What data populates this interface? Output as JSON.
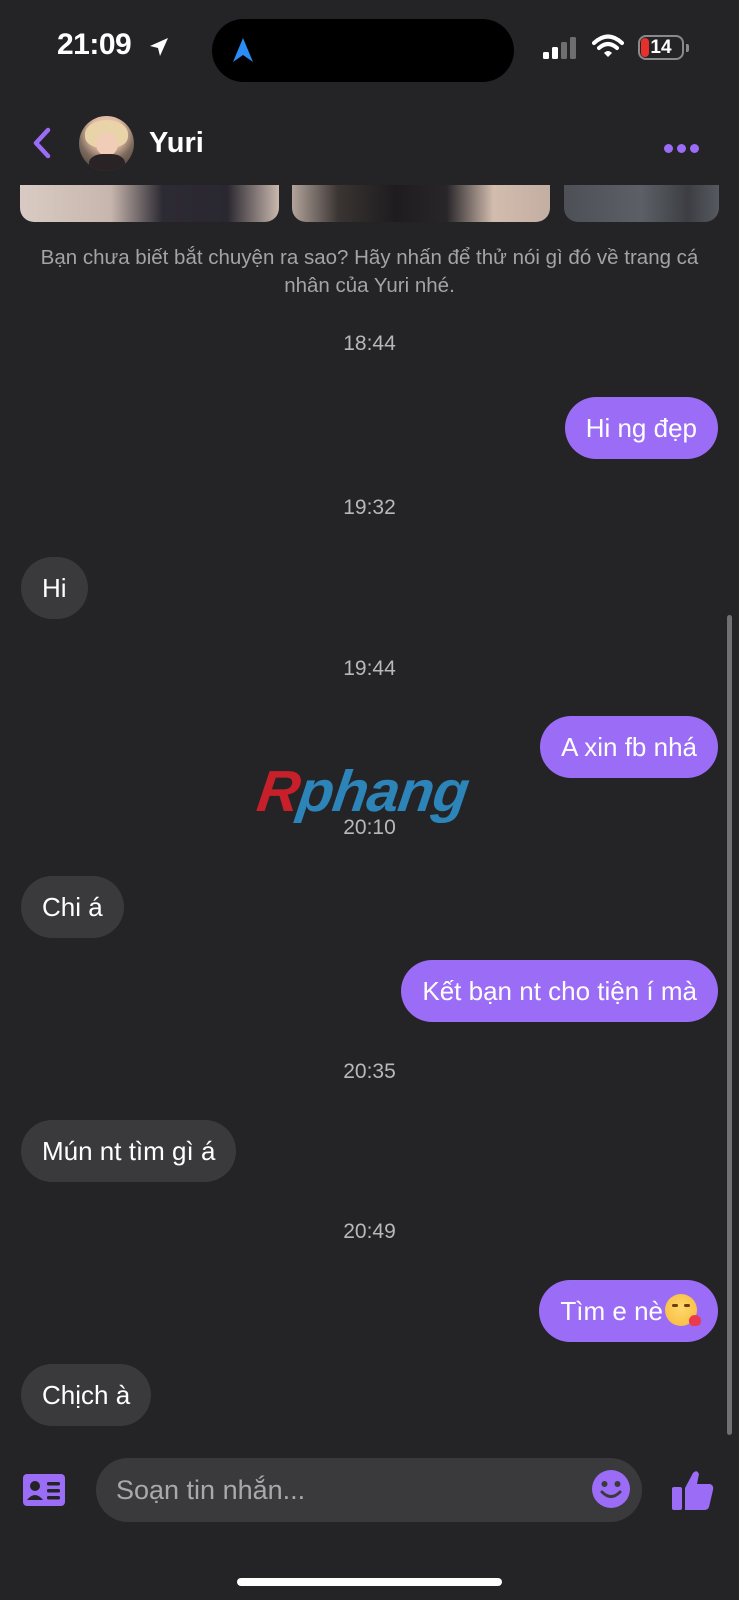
{
  "status_bar": {
    "time": "21:09",
    "battery": "14",
    "icons": [
      "location-arrow-icon",
      "navigation-icon",
      "signal-icon",
      "wifi-icon",
      "battery-icon"
    ]
  },
  "header": {
    "contact_name": "Yuri",
    "icons": [
      "back-chevron-icon",
      "avatar",
      "more-dots-icon"
    ],
    "accent_color": "#9b6cf6"
  },
  "intro": {
    "text": "Bạn chưa biết bắt chuyện ra sao? Hãy nhấn để thử nói gì đó về trang cá nhân của Yuri nhé."
  },
  "messages": [
    {
      "type": "timestamp",
      "text": "18:44"
    },
    {
      "type": "outgoing",
      "text": "Hi ng đẹp"
    },
    {
      "type": "timestamp",
      "text": "19:32"
    },
    {
      "type": "incoming",
      "text": "Hi"
    },
    {
      "type": "timestamp",
      "text": "19:44"
    },
    {
      "type": "outgoing",
      "text": "A xin fb nhá"
    },
    {
      "type": "timestamp",
      "text": "20:10"
    },
    {
      "type": "incoming",
      "text": "Chi á"
    },
    {
      "type": "outgoing",
      "text": "Kết bạn nt cho tiện í mà"
    },
    {
      "type": "timestamp",
      "text": "20:35"
    },
    {
      "type": "incoming",
      "text": "Mún nt tìm gì á"
    },
    {
      "type": "timestamp",
      "text": "20:49"
    },
    {
      "type": "outgoing",
      "text": "Tìm e nè",
      "emoji": "kissing-face-emoji"
    },
    {
      "type": "incoming",
      "text": "Chịch à"
    }
  ],
  "watermark": {
    "part1": "R",
    "part2": "phang"
  },
  "composer": {
    "placeholder": "Soạn tin nhắn...",
    "icons": [
      "contact-card-icon",
      "emoji-smile-icon",
      "thumbs-up-icon"
    ]
  },
  "colors": {
    "background": "#242426",
    "outgoing_bubble": "#9b6cf6",
    "incoming_bubble": "#3a3a3d"
  }
}
